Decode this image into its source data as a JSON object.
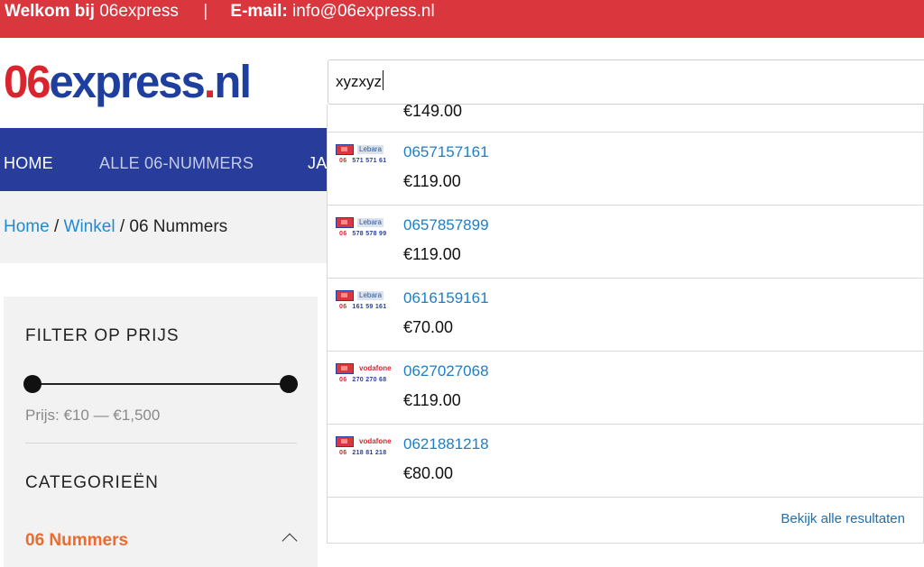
{
  "topbar": {
    "welcome_bold": "Welkom bij",
    "site": "06express",
    "separator": "|",
    "email_label": "E-mail:",
    "email": "info@06express.nl"
  },
  "logo": {
    "part1": "06",
    "part2": "express",
    "part3": ".",
    "part4": "nl"
  },
  "search": {
    "value": "xyzxyz"
  },
  "nav": {
    "items": [
      "HOME",
      "ALLE 06-NUMMERS",
      "JA"
    ]
  },
  "breadcrumb": {
    "home": "Home",
    "sep": " / ",
    "shop": "Winkel",
    "current": "06 Nummers"
  },
  "sidebar": {
    "filter_title": "FILTER OP PRIJS",
    "price_range": "Prijs: €10 — €1,500",
    "categories_title": "CATEGORIEËN",
    "category": "06 Nummers"
  },
  "dropdown": {
    "partial_price": "€149.00",
    "results": [
      {
        "carrier": "Lebara",
        "thumb_prefix": "06",
        "thumb_number": "571 571 61",
        "number": "0657157161",
        "price": "€119.00"
      },
      {
        "carrier": "Lebara",
        "thumb_prefix": "06",
        "thumb_number": "578 578 99",
        "number": "0657857899",
        "price": "€119.00"
      },
      {
        "carrier": "Lebara",
        "thumb_prefix": "06",
        "thumb_number": "161 59 161",
        "number": "0616159161",
        "price": "€70.00"
      },
      {
        "carrier": "vodafone",
        "thumb_prefix": "06",
        "thumb_number": "270 270 68",
        "number": "0627027068",
        "price": "€119.00"
      },
      {
        "carrier": "vodafone",
        "thumb_prefix": "06",
        "thumb_number": "218 81 218",
        "number": "0621881218",
        "price": "€80.00"
      }
    ],
    "view_all": "Bekijk alle resultaten"
  },
  "colors": {
    "topbar": "#d9363e",
    "nav": "#283d9b",
    "link": "#1f8bd1",
    "category": "#ec6b2d"
  }
}
